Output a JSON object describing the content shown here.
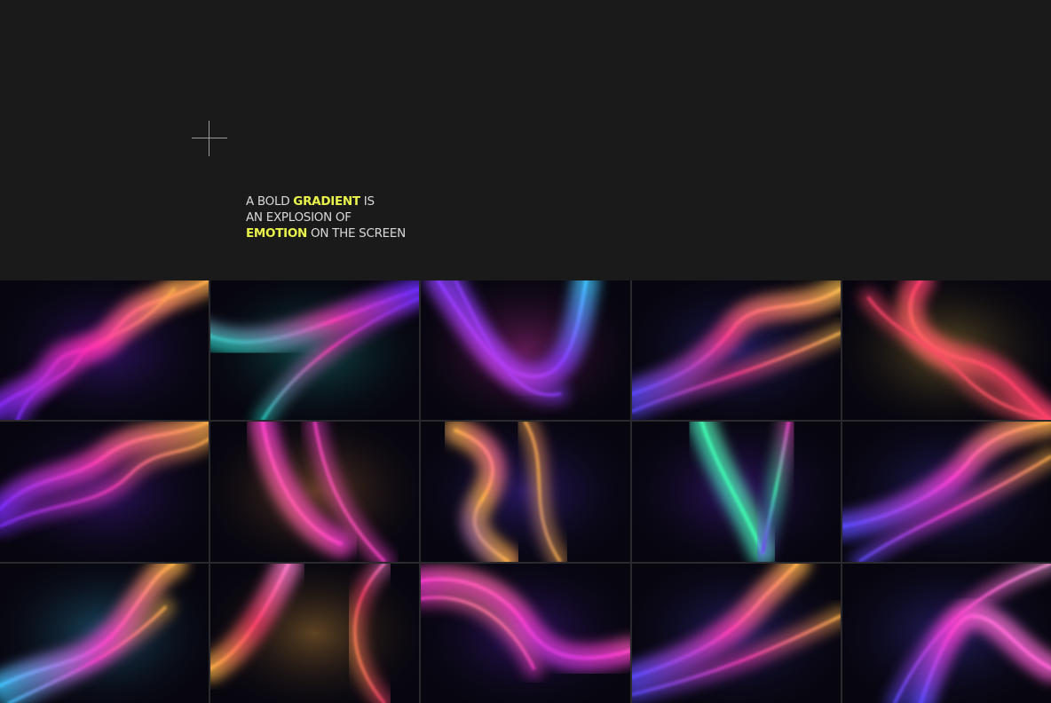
{
  "tagline": {
    "line1_pre": "A BOLD ",
    "line1_highlight": "GRADIENT",
    "line1_post": " IS",
    "line2": "AN EXPLOSION OF",
    "line3_highlight": "EMOTION",
    "line3_post": " ON THE SCREEN"
  },
  "colors": {
    "background": "#1a1a1b",
    "highlight": "#e9f34a",
    "text": "#d9d9d9"
  },
  "icons": [
    "plus-icon"
  ],
  "gallery": {
    "tiles": [
      {
        "name": "gradient-tile-1",
        "c1": "#ff2fb0",
        "c2": "#ffb347",
        "c3": "#7a2cff",
        "paths": [
          "M-10,150 C30,120 40,130 60,100 C80,70 110,90 130,60 C160,20 180,30 240,0",
          "M20,160 C40,110 70,120 90,90 C110,60 150,70 200,10"
        ]
      },
      {
        "name": "gradient-tile-2",
        "c1": "#ff3fb5",
        "c2": "#6b2cff",
        "c3": "#1dd3c0",
        "paths": [
          "M-10,60 C60,90 120,50 240,10",
          "M60,160 C90,110 150,60 240,20"
        ]
      },
      {
        "name": "gradient-tile-3",
        "c1": "#8a3bff",
        "c2": "#3ec7ff",
        "c3": "#ff3fd0",
        "paths": [
          "M20,0 C60,60 90,110 130,110 C170,110 180,60 190,0",
          "M40,0 C80,80 110,140 160,130"
        ]
      },
      {
        "name": "gradient-tile-4",
        "c1": "#ff3f8f",
        "c2": "#ffc04d",
        "c3": "#5a4bff",
        "paths": [
          "M0,130 C60,110 90,90 120,50 C150,20 190,40 240,10",
          "M0,150 C70,120 130,110 240,60"
        ]
      },
      {
        "name": "gradient-tile-5",
        "c1": "#ff3f6a",
        "c2": "#ff5fd9",
        "c3": "#ffd24d",
        "paths": [
          "M90,0 C60,40 90,80 140,90 C190,100 200,130 240,160",
          "M30,20 C60,60 100,70 140,110 C170,140 200,150 240,160"
        ]
      },
      {
        "name": "gradient-tile-6",
        "c1": "#ff3fb5",
        "c2": "#ffb347",
        "c3": "#7a2cff",
        "paths": [
          "M0,100 C40,60 80,70 120,40 C160,10 200,20 240,0",
          "M0,120 C60,90 110,100 150,60 C180,30 210,40 240,20"
        ]
      },
      {
        "name": "gradient-tile-7",
        "c1": "#ff3fd0",
        "c2": "#7a2cff",
        "c3": "#ff9f4d",
        "paths": [
          "M60,0 C70,60 100,120 150,140",
          "M120,0 C130,60 150,110 200,160"
        ]
      },
      {
        "name": "gradient-tile-8",
        "c1": "#ffb347",
        "c2": "#ff3fd0",
        "c3": "#6a3bff",
        "paths": [
          "M40,10 C90,30 90,60 70,90 C50,120 70,140 100,160",
          "M120,0 C150,50 120,100 160,160"
        ]
      },
      {
        "name": "gradient-tile-9",
        "c1": "#3effb0",
        "c2": "#ff3fd0",
        "c3": "#7a2cff",
        "paths": [
          "M80,0 C100,60 130,100 150,150",
          "M180,0 C170,60 160,100 150,150"
        ]
      },
      {
        "name": "gradient-tile-10",
        "c1": "#ff3fd0",
        "c2": "#ffb347",
        "c3": "#5a4bff",
        "paths": [
          "M0,120 C60,110 120,80 150,40 C170,20 190,10 240,0",
          "M20,160 C80,120 140,100 240,40"
        ]
      },
      {
        "name": "gradient-tile-11",
        "c1": "#ff3fd0",
        "c2": "#ffb347",
        "c3": "#3ec7ff",
        "paths": [
          "M0,140 C60,110 100,120 140,70 C170,30 180,10 200,0",
          "M10,160 C70,130 130,110 190,50"
        ]
      },
      {
        "name": "gradient-tile-12",
        "c1": "#ff3f6a",
        "c2": "#ff7fd0",
        "c3": "#ffb347",
        "paths": [
          "M90,0 C70,40 40,100 0,120",
          "M200,0 C160,40 150,100 200,160"
        ]
      },
      {
        "name": "gradient-tile-13",
        "c1": "#ff3fd0",
        "c2": "#ffd24d",
        "c3": "#7a2cff",
        "paths": [
          "M0,20 C60,10 100,40 120,70 C140,100 170,120 240,100",
          "M0,40 C70,30 110,80 130,120"
        ]
      },
      {
        "name": "gradient-tile-14",
        "c1": "#ff3fb5",
        "c2": "#ffb347",
        "c3": "#5a4bff",
        "paths": [
          "M0,130 C60,110 110,90 150,40 C170,20 180,10 190,0",
          "M0,150 C80,130 140,110 240,60"
        ]
      },
      {
        "name": "gradient-tile-15",
        "c1": "#ff3fd0",
        "c2": "#ff9fe0",
        "c3": "#5a4bff",
        "paths": [
          "M90,160 C110,100 130,60 150,60 C180,60 200,100 240,120",
          "M60,160 C90,100 130,40 240,0"
        ]
      }
    ]
  }
}
